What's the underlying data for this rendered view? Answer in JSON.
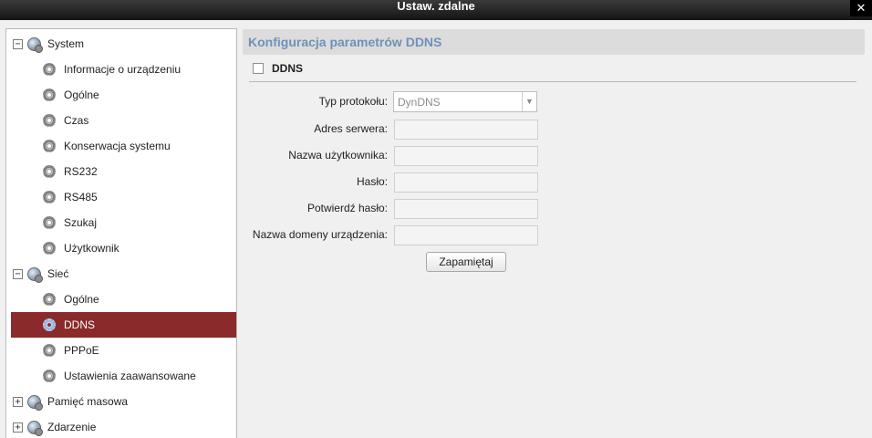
{
  "window": {
    "title": "Ustaw. zdalne",
    "close_label": "✕"
  },
  "tree": {
    "system": {
      "label": "System",
      "toggle": "−",
      "children": [
        "Informacje o urządzeniu",
        "Ogólne",
        "Czas",
        "Konserwacja systemu",
        "RS232",
        "RS485",
        "Szukaj",
        "Użytkownik"
      ]
    },
    "siec": {
      "label": "Sieć",
      "toggle": "−",
      "children": [
        "Ogólne",
        "DDNS",
        "PPPoE",
        "Ustawienia zaawansowane"
      ],
      "selected": "DDNS"
    },
    "pamiec": {
      "label": "Pamięć masowa",
      "toggle": "+"
    },
    "zdarzenie": {
      "label": "Zdarzenie",
      "toggle": "+"
    }
  },
  "panel": {
    "title": "Konfiguracja parametrów DDNS",
    "ddns_checkbox_label": "DDNS",
    "ddns_enabled": false,
    "fields": {
      "protocol_label": "Typ protokołu:",
      "protocol_value": "DynDNS",
      "server_label": "Adres serwera:",
      "username_label": "Nazwa użytkownika:",
      "password_label": "Hasło:",
      "confirm_label": "Potwierdź hasło:",
      "domain_label": "Nazwa domeny urządzenia:"
    },
    "save_label": "Zapamiętaj"
  },
  "colors": {
    "selection": "#8a2a2a",
    "header_text": "#6f91b8",
    "titlebar": "#1e1e1e"
  }
}
